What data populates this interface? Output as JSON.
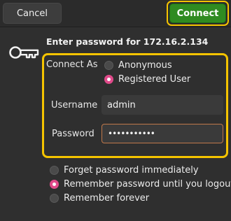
{
  "header": {
    "cancel_label": "Cancel",
    "connect_label": "Connect"
  },
  "dialog": {
    "title": "Enter password for 172.16.2.134",
    "connect_as_label": "Connect As",
    "anonymous_label": "Anonymous",
    "registered_label": "Registered User",
    "connect_as_selected": "Registered User",
    "username_label": "Username",
    "username_value": "admin",
    "password_label": "Password",
    "password_value": "•••••••••••"
  },
  "remember": {
    "selected": "Remember password until you logout",
    "options": [
      "Forget password immediately",
      "Remember password until you logout",
      "Remember forever"
    ]
  },
  "colors": {
    "accent_pink": "#e04a8a",
    "connect_green": "#2f8b21",
    "highlight_yellow": "#f5c400"
  },
  "icons": {
    "key": "key-icon"
  }
}
